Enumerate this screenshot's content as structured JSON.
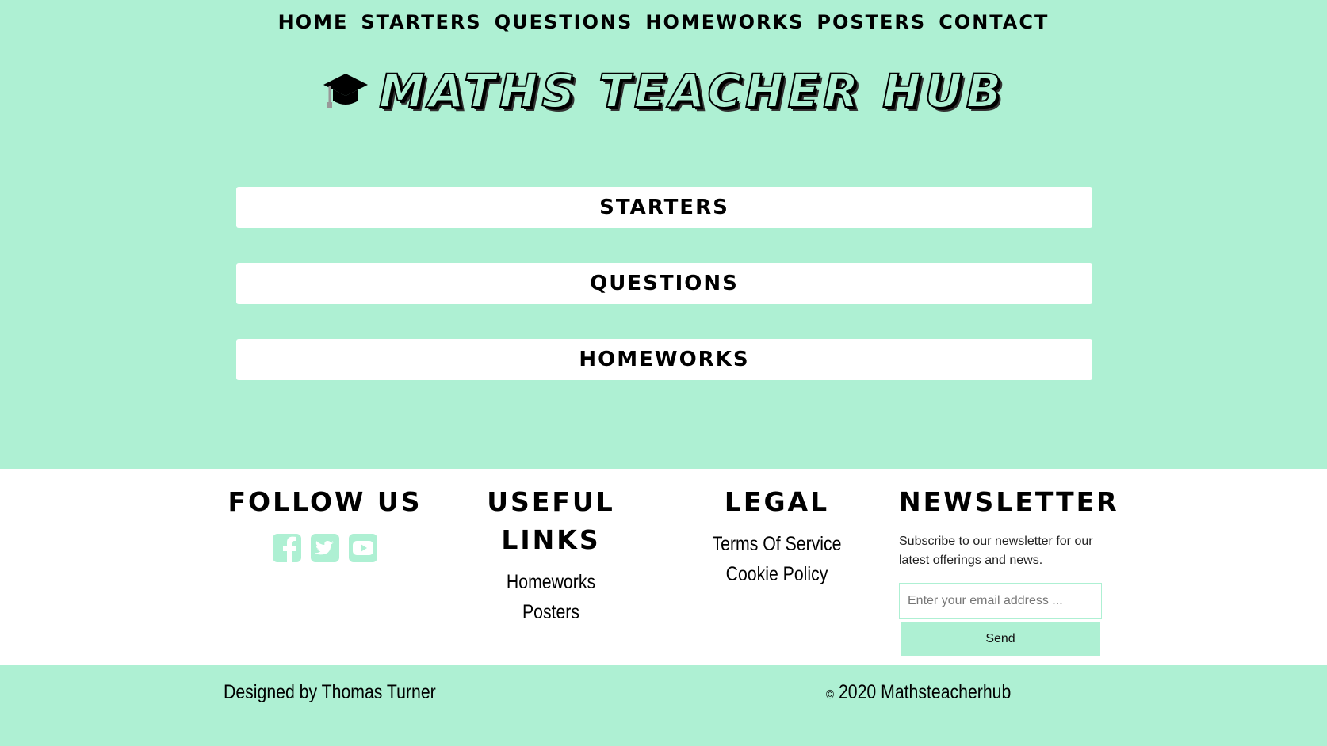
{
  "nav": {
    "items": [
      {
        "label": "Home"
      },
      {
        "label": "Starters"
      },
      {
        "label": "Questions"
      },
      {
        "label": "Homeworks"
      },
      {
        "label": "Posters"
      },
      {
        "label": "Contact"
      }
    ]
  },
  "logo": {
    "icon": "graduation-cap-icon",
    "title": "Maths Teacher Hub"
  },
  "categories": [
    {
      "label": "Starters"
    },
    {
      "label": "Questions"
    },
    {
      "label": "Homeworks"
    }
  ],
  "footer": {
    "follow": {
      "heading": "Follow Us",
      "icons": [
        "facebook-icon",
        "twitter-icon",
        "youtube-icon"
      ],
      "icon_color": "#aef0d3"
    },
    "useful_links": {
      "heading": "Useful Links",
      "links": [
        {
          "label": "Homeworks"
        },
        {
          "label": "Posters"
        }
      ]
    },
    "legal": {
      "heading": "Legal",
      "links": [
        {
          "label": "Terms Of Service"
        },
        {
          "label": "Cookie Policy"
        }
      ]
    },
    "newsletter": {
      "heading": "Newsletter",
      "text": "Subscribe to our newsletter for our latest offerings and news.",
      "placeholder": "Enter your email address ...",
      "button": "Send"
    }
  },
  "bottom": {
    "credit": "Designed by Thomas Turner",
    "copyright_symbol": "©",
    "copyright": "2020 Mathsteacherhub"
  },
  "colors": {
    "background": "#aef0d3",
    "panel": "#ffffff",
    "text": "#000000"
  }
}
